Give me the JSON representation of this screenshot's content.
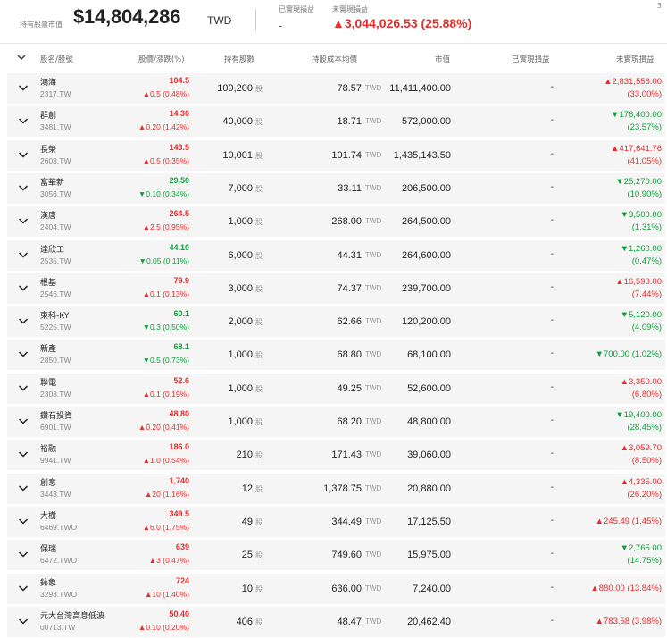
{
  "header": {
    "market_value_label": "持有股票市值",
    "market_value": "$14,804,286",
    "currency": "TWD",
    "realized_label": "已實現損益",
    "realized_value": "-",
    "unrealized_label": "未實現損益",
    "unrealized_value": "▲3,044,026.53 (25.88%)",
    "page_indicator": "3"
  },
  "columns": {
    "name": "股名/股號",
    "price": "股價/漲跌(%)",
    "shares": "持有股數",
    "cost": "持股成本均價",
    "market_value": "市值",
    "realized": "已實現損益",
    "unrealized": "未實現損益"
  },
  "colors": {
    "up": "#e62c2c",
    "down": "#0d9d3a",
    "row_bg": "#f5f5f5"
  },
  "units": {
    "shares": "股",
    "cost_currency": "TWD"
  },
  "rows": [
    {
      "name": "鴻海",
      "code": "2317.TW",
      "price": "104.5",
      "change": "▲0.5 (0.48%)",
      "dir": "up",
      "shares": "109,200",
      "cost": "78.57",
      "mv": "11,411,400.00",
      "realized": "-",
      "ul_dir": "up",
      "ul1": "▲2,831,556.00",
      "ul2": "(33.00%)"
    },
    {
      "name": "群創",
      "code": "3481.TW",
      "price": "14.30",
      "change": "▲0.20 (1.42%)",
      "dir": "up",
      "shares": "40,000",
      "cost": "18.71",
      "mv": "572,000.00",
      "realized": "-",
      "ul_dir": "down",
      "ul1": "▼176,400.00",
      "ul2": "(23.57%)"
    },
    {
      "name": "長榮",
      "code": "2603.TW",
      "price": "143.5",
      "change": "▲0.5 (0.35%)",
      "dir": "up",
      "shares": "10,001",
      "cost": "101.74",
      "mv": "1,435,143.50",
      "realized": "-",
      "ul_dir": "up",
      "ul1": "▲417,641.76",
      "ul2": "(41.05%)"
    },
    {
      "name": "富華新",
      "code": "3056.TW",
      "price": "29.50",
      "change": "▼0.10 (0.34%)",
      "dir": "down",
      "shares": "7,000",
      "cost": "33.11",
      "mv": "206,500.00",
      "realized": "-",
      "ul_dir": "down",
      "ul1": "▼25,270.00",
      "ul2": "(10.90%)"
    },
    {
      "name": "漢唐",
      "code": "2404.TW",
      "price": "264.5",
      "change": "▲2.5 (0.95%)",
      "dir": "up",
      "shares": "1,000",
      "cost": "268.00",
      "mv": "264,500.00",
      "realized": "-",
      "ul_dir": "down",
      "ul1": "▼3,500.00",
      "ul2": "(1.31%)"
    },
    {
      "name": "達欣工",
      "code": "2535.TW",
      "price": "44.10",
      "change": "▼0.05 (0.11%)",
      "dir": "down",
      "shares": "6,000",
      "cost": "44.31",
      "mv": "264,600.00",
      "realized": "-",
      "ul_dir": "down",
      "ul1": "▼1,260.00",
      "ul2": "(0.47%)"
    },
    {
      "name": "根基",
      "code": "2546.TW",
      "price": "79.9",
      "change": "▲0.1 (0.13%)",
      "dir": "up",
      "shares": "3,000",
      "cost": "74.37",
      "mv": "239,700.00",
      "realized": "-",
      "ul_dir": "up",
      "ul1": "▲16,590.00",
      "ul2": "(7.44%)"
    },
    {
      "name": "東科-KY",
      "code": "5225.TW",
      "price": "60.1",
      "change": "▼0.3 (0.50%)",
      "dir": "down",
      "shares": "2,000",
      "cost": "62.66",
      "mv": "120,200.00",
      "realized": "-",
      "ul_dir": "down",
      "ul1": "▼5,120.00",
      "ul2": "(4.09%)"
    },
    {
      "name": "新產",
      "code": "2850.TW",
      "price": "68.1",
      "change": "▼0.5 (0.73%)",
      "dir": "down",
      "shares": "1,000",
      "cost": "68.80",
      "mv": "68,100.00",
      "realized": "-",
      "ul_dir": "down",
      "ul1": "▼700.00 (1.02%)",
      "ul2": ""
    },
    {
      "name": "聯電",
      "code": "2303.TW",
      "price": "52.6",
      "change": "▲0.1 (0.19%)",
      "dir": "up",
      "shares": "1,000",
      "cost": "49.25",
      "mv": "52,600.00",
      "realized": "-",
      "ul_dir": "up",
      "ul1": "▲3,350.00",
      "ul2": "(6.80%)"
    },
    {
      "name": "鑽石投資",
      "code": "6901.TW",
      "price": "48.80",
      "change": "▲0.20 (0.41%)",
      "dir": "up",
      "shares": "1,000",
      "cost": "68.20",
      "mv": "48,800.00",
      "realized": "-",
      "ul_dir": "down",
      "ul1": "▼19,400.00",
      "ul2": "(28.45%)"
    },
    {
      "name": "裕融",
      "code": "9941.TW",
      "price": "186.0",
      "change": "▲1.0 (0.54%)",
      "dir": "up",
      "shares": "210",
      "cost": "171.43",
      "mv": "39,060.00",
      "realized": "-",
      "ul_dir": "up",
      "ul1": "▲3,059.70",
      "ul2": "(8.50%)"
    },
    {
      "name": "創意",
      "code": "3443.TW",
      "price": "1,740",
      "change": "▲20 (1.16%)",
      "dir": "up",
      "shares": "12",
      "cost": "1,378.75",
      "mv": "20,880.00",
      "realized": "-",
      "ul_dir": "up",
      "ul1": "▲4,335.00",
      "ul2": "(26.20%)"
    },
    {
      "name": "大樹",
      "code": "6469.TWO",
      "price": "349.5",
      "change": "▲6.0 (1.75%)",
      "dir": "up",
      "shares": "49",
      "cost": "344.49",
      "mv": "17,125.50",
      "realized": "-",
      "ul_dir": "up",
      "ul1": "▲245.49 (1.45%)",
      "ul2": ""
    },
    {
      "name": "保瑞",
      "code": "6472.TWO",
      "price": "639",
      "change": "▲3 (0.47%)",
      "dir": "up",
      "shares": "25",
      "cost": "749.60",
      "mv": "15,975.00",
      "realized": "-",
      "ul_dir": "down",
      "ul1": "▼2,765.00",
      "ul2": "(14.75%)"
    },
    {
      "name": "鈊象",
      "code": "3293.TWO",
      "price": "724",
      "change": "▲10 (1.40%)",
      "dir": "up",
      "shares": "10",
      "cost": "636.00",
      "mv": "7,240.00",
      "realized": "-",
      "ul_dir": "up",
      "ul1": "▲880.00 (13.84%)",
      "ul2": ""
    },
    {
      "name": "元大台灣高息低波",
      "code": "00713.TW",
      "price": "50.40",
      "change": "▲0.10 (0.20%)",
      "dir": "up",
      "shares": "406",
      "cost": "48.47",
      "mv": "20,462.40",
      "realized": "-",
      "ul_dir": "up",
      "ul1": "▲783.58 (3.98%)",
      "ul2": ""
    }
  ]
}
